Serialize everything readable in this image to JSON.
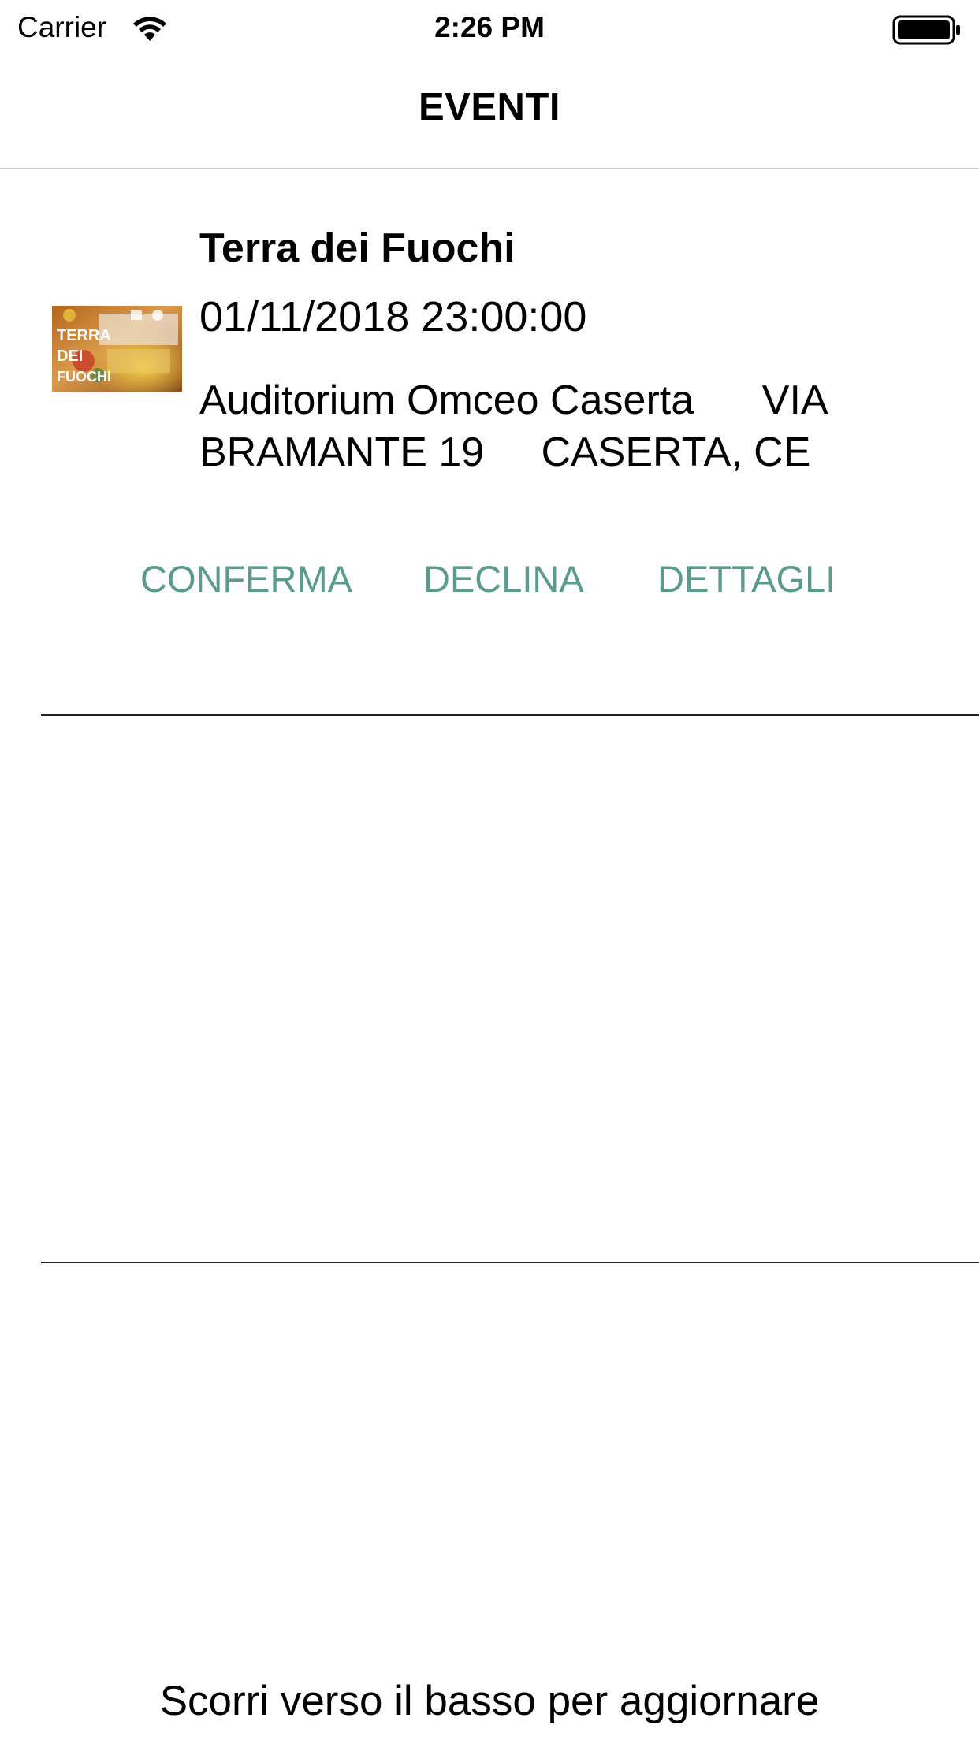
{
  "status_bar": {
    "carrier": "Carrier",
    "time": "2:26 PM",
    "wifi_icon": "wifi-icon",
    "battery_icon": "battery-icon"
  },
  "nav": {
    "title": "EVENTI"
  },
  "events": [
    {
      "title": "Terra dei Fuochi",
      "datetime": "01/11/2018 23:00:00",
      "location": "Auditorium Omceo Caserta      VIA BRAMANTE 19     CASERTA, CE",
      "thumbnail_text": "TERRA DEI FUOCHI",
      "actions": {
        "confirm": "CONFERMA",
        "decline": "DECLINA",
        "details": "DETTAGLI"
      }
    }
  ],
  "footer": {
    "pull_to_refresh": "Scorri verso il basso per aggiornare"
  },
  "colors": {
    "accent": "#5a9c8c",
    "divider": "#c8c7cc",
    "text": "#000000",
    "background": "#ffffff"
  }
}
